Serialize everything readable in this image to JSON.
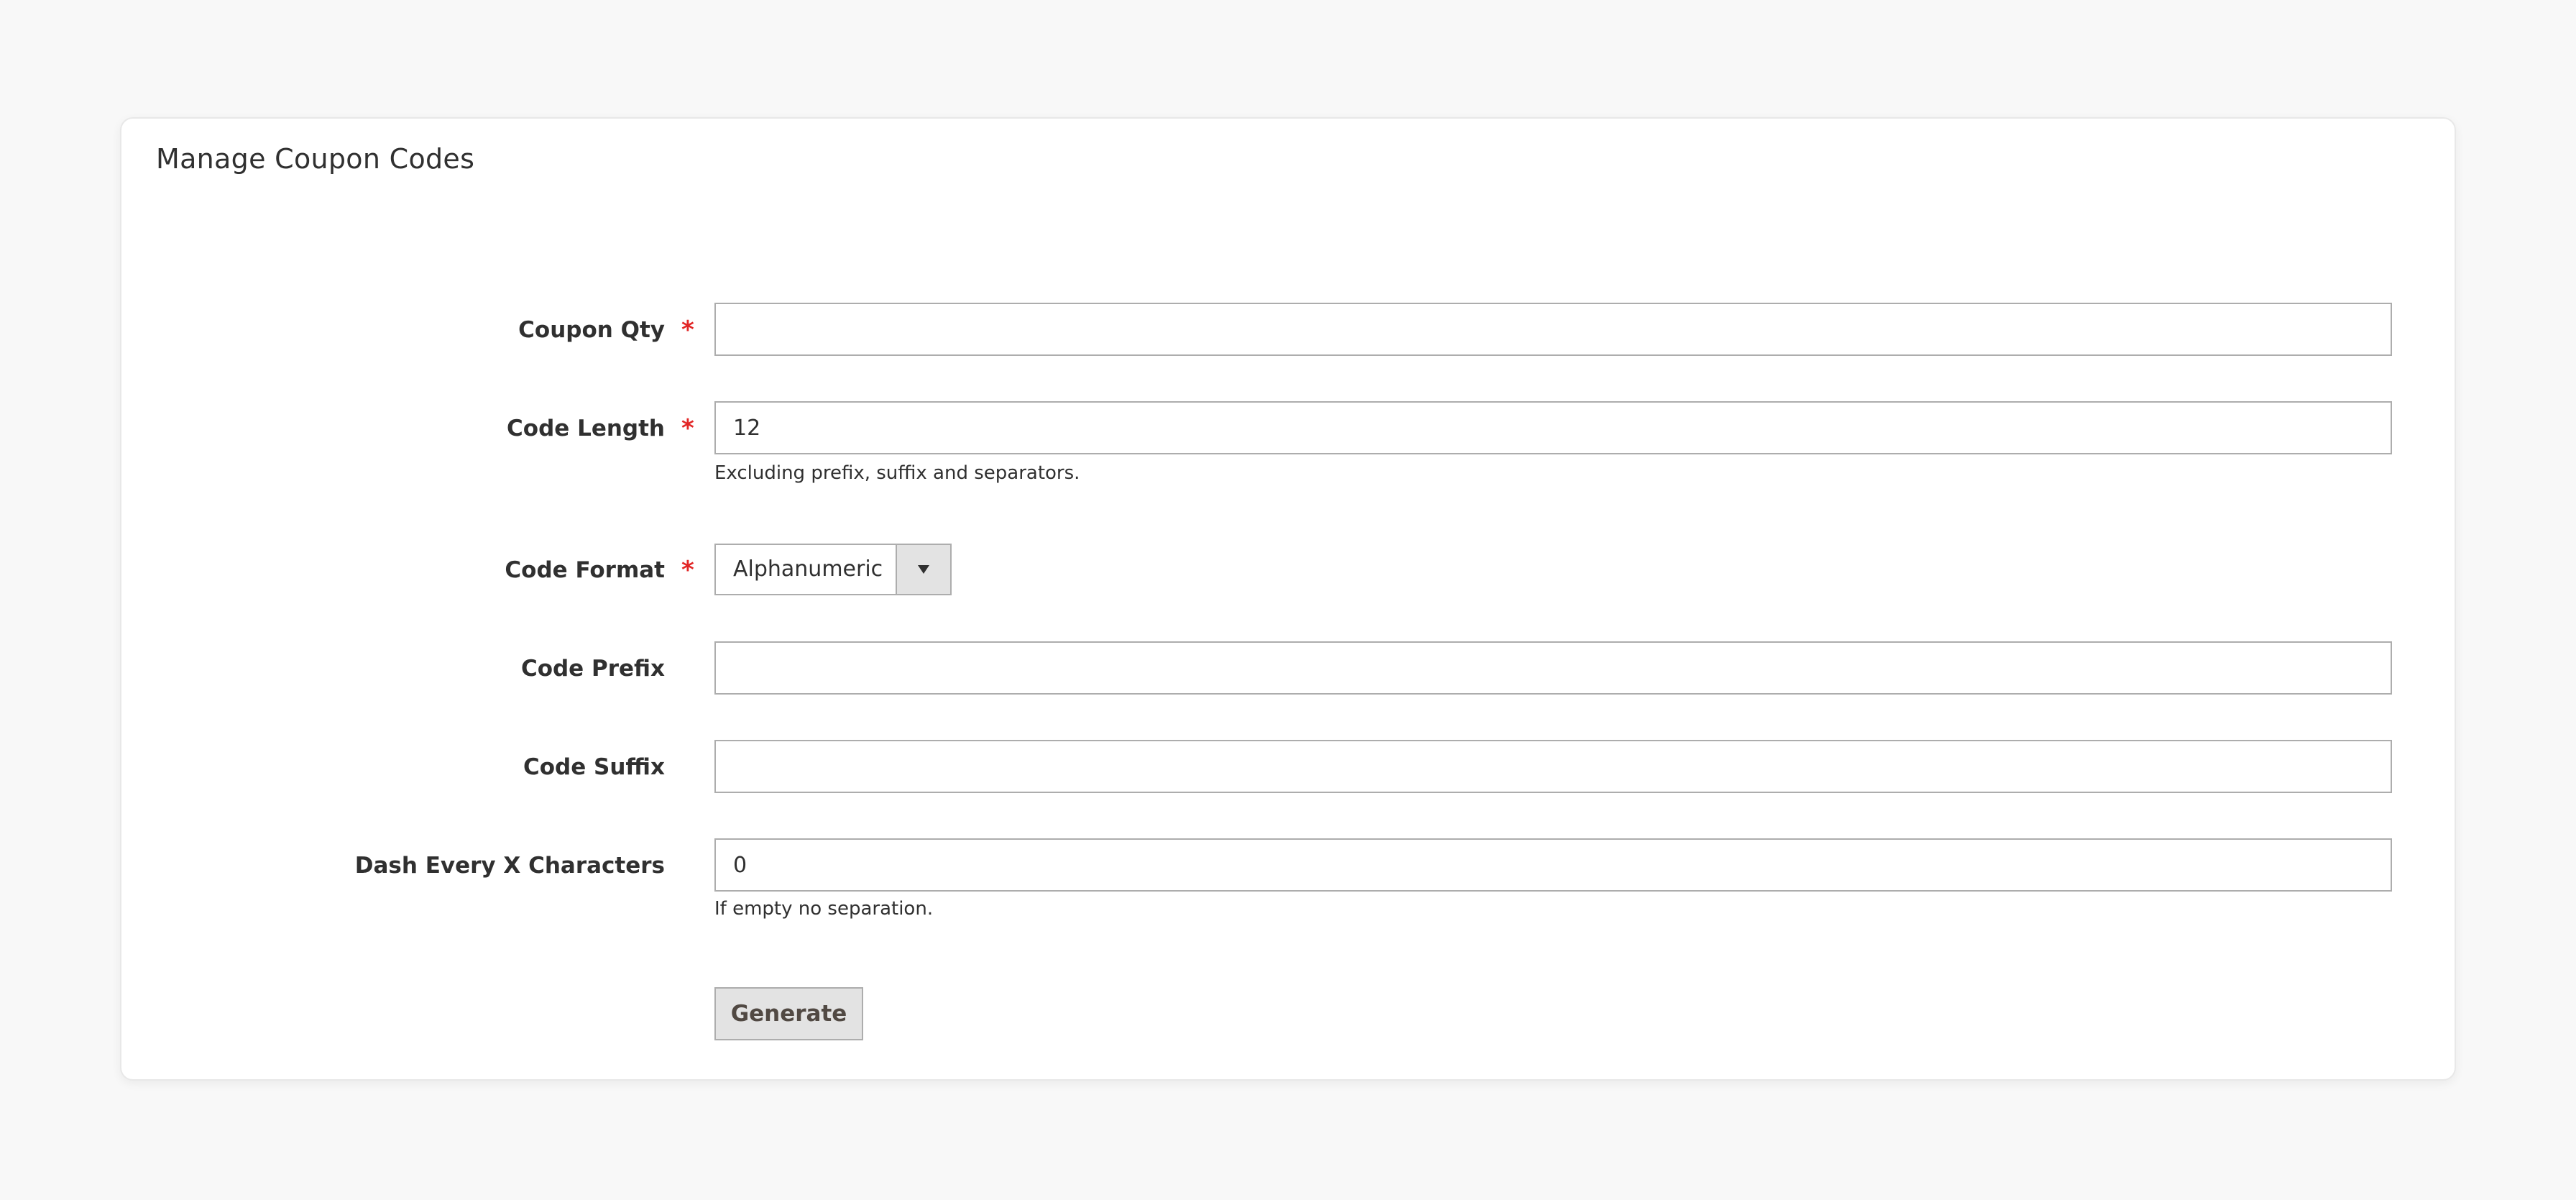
{
  "panel": {
    "title": "Manage Coupon Codes"
  },
  "form": {
    "coupon_qty": {
      "label": "Coupon Qty",
      "required": "*",
      "value": ""
    },
    "code_length": {
      "label": "Code Length",
      "required": "*",
      "value": "12",
      "note": "Excluding prefix, suffix and separators."
    },
    "code_format": {
      "label": "Code Format",
      "required": "*",
      "selected": "Alphanumeric"
    },
    "code_prefix": {
      "label": "Code Prefix",
      "value": ""
    },
    "code_suffix": {
      "label": "Code Suffix",
      "value": ""
    },
    "dash_every": {
      "label": "Dash Every X Characters",
      "value": "0",
      "note": "If empty no separation."
    },
    "generate_label": "Generate"
  },
  "colors": {
    "required": "#e22626",
    "background": "#f8f8f8",
    "button": "#e3e3e3"
  }
}
